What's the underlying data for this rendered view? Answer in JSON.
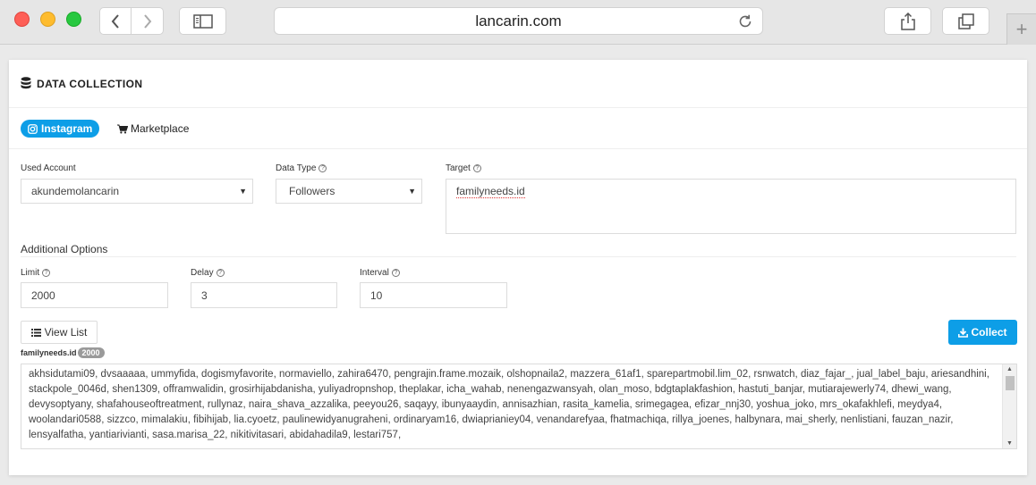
{
  "browser": {
    "url": "lancarin.com",
    "plus_label": "+"
  },
  "page": {
    "title": "DATA COLLECTION",
    "tabs": [
      {
        "label": "Instagram",
        "active": true
      },
      {
        "label": "Marketplace",
        "active": false
      }
    ],
    "used_account": {
      "label": "Used Account",
      "value": "akundemolancarin"
    },
    "data_type": {
      "label": "Data Type",
      "value": "Followers"
    },
    "target": {
      "label": "Target",
      "value": "familyneeds.id"
    },
    "additional_options": "Additional Options",
    "limit": {
      "label": "Limit",
      "value": "2000"
    },
    "delay": {
      "label": "Delay",
      "value": "3"
    },
    "interval": {
      "label": "Interval",
      "value": "10"
    },
    "view_list_label": "View List",
    "collect_label": "Collect",
    "result_label": "familyneeds.id",
    "result_count": "2000",
    "result_text": "akhsidutami09, dvsaaaaa, ummyfida, dogismyfavorite, normaviello, zahira6470, pengrajin.frame.mozaik, olshopnaila2, mazzera_61af1, sparepartmobil.lim_02, rsnwatch, diaz_fajar_, jual_label_baju, ariesandhini, stackpole_0046d, shen1309, offramwalidin, grosirhijabdanisha, yuliyadropnshop, theplakar, icha_wahab, nenengazwansyah, olan_moso, bdgtaplakfashion, hastuti_banjar, mutiarajewerly74, dhewi_wang, devysoptyany, shafahouseoftreatment, rullynaz, naira_shava_azzalika, peeyou26, saqayy, ibunyaaydin, annisazhian, rasita_kamelia, srimegagea, efizar_nnj30, yoshua_joko, mrs_okafakhlefi, meydya4, woolandari0588, sizzco, mimalakiu, fibihijab, lia.cyoetz, paulinewidyanugraheni, ordinaryam16, dwiaprianiey04, venandarefyaa, fhatmachiqa, rillya_joenes, halbynara, mai_sherly, nenlistiani, fauzan_nazir, lensyalfatha, yantiarivianti, sasa.marisa_22, nikitivitasari, abidahadila9, lestari757,",
    "help_glyph": "?"
  }
}
